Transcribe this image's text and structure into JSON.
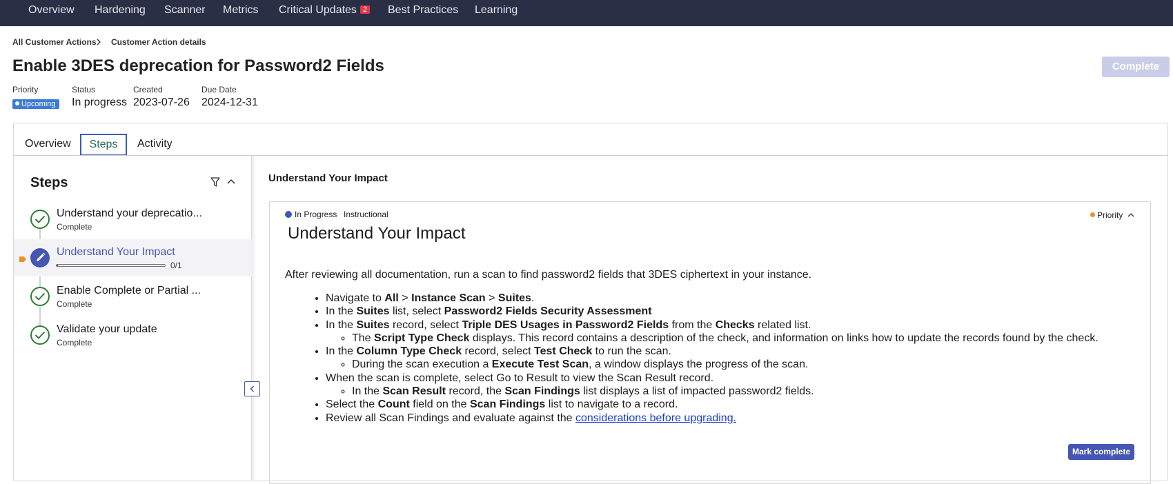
{
  "topnav": {
    "items": [
      "Overview",
      "Hardening",
      "Scanner",
      "Metrics",
      "Critical Updates",
      "Best Practices",
      "Learning"
    ],
    "critical_badge": "2"
  },
  "breadcrumb": {
    "root": "All Customer Actions",
    "current": "Customer Action details"
  },
  "page": {
    "title": "Enable 3DES deprecation for Password2 Fields",
    "complete_label": "Complete"
  },
  "meta": {
    "priority_label": "Priority",
    "priority_value": "Upcoming",
    "status_label": "Status",
    "status_value": "In progress",
    "created_label": "Created",
    "created_value": "2023-07-26",
    "due_label": "Due Date",
    "due_value": "2024-12-31"
  },
  "tabs": [
    "Overview",
    "Steps",
    "Activity"
  ],
  "steps_panel": {
    "title": "Steps",
    "steps": [
      {
        "title": "Understand your deprecatio...",
        "subtitle": "Complete"
      },
      {
        "title": "Understand Your Impact",
        "progress_text": "0/1",
        "progress_fraction": 0
      },
      {
        "title": "Enable Complete or Partial ...",
        "subtitle": "Complete"
      },
      {
        "title": "Validate your update",
        "subtitle": "Complete"
      }
    ]
  },
  "content": {
    "section_heading": "Understand Your Impact",
    "status": "In Progress",
    "type": "Instructional",
    "priority": "Priority",
    "title": "Understand Your Impact",
    "intro": "After reviewing all documentation, run a scan to find password2 fields that 3DES ciphertext in your instance.",
    "instructions": {
      "i1_a": "Navigate to ",
      "i1_b": "All",
      "i1_c": " > ",
      "i1_d": "Instance Scan",
      "i1_e": " > ",
      "i1_f": "Suites",
      "i1_g": ".",
      "i2_a": "In the ",
      "i2_b": "Suites",
      "i2_c": " list, select ",
      "i2_d": "Password2 Fields Security Assessment",
      "i3_a": "In the ",
      "i3_b": "Suites",
      "i3_c": " record, select ",
      "i3_d": "Triple DES Usages in Password2 Fields",
      "i3_e": " from the ",
      "i3_f": "Checks",
      "i3_g": " related list.",
      "i3s_a": "The ",
      "i3s_b": "Script Type Check",
      "i3s_c": " displays. This record contains a description of the check, and information on links how to update the records found by the check.",
      "i4_a": "In the ",
      "i4_b": "Column Type Check",
      "i4_c": " record, select ",
      "i4_d": "Test Check",
      "i4_e": " to run the scan.",
      "i4s_a": "During the scan execution a ",
      "i4s_b": "Execute Test Scan",
      "i4s_c": ", a window displays the progress of the scan.",
      "i5": "When the scan is complete, select Go to Result to view the Scan Result record.",
      "i5s_a": "In the ",
      "i5s_b": "Scan Result",
      "i5s_c": " record, the ",
      "i5s_d": "Scan Findings",
      "i5s_e": " list displays a list of impacted password2 fields.",
      "i6_a": "Select the ",
      "i6_b": "Count",
      "i6_c": " field on the ",
      "i6_d": "Scan Findings",
      "i6_e": " list to navigate to a record.",
      "i7_a": "Review all Scan Findings and evaluate against the ",
      "i7_link": "considerations before upgrading."
    },
    "mark_complete_label": "Mark complete"
  }
}
